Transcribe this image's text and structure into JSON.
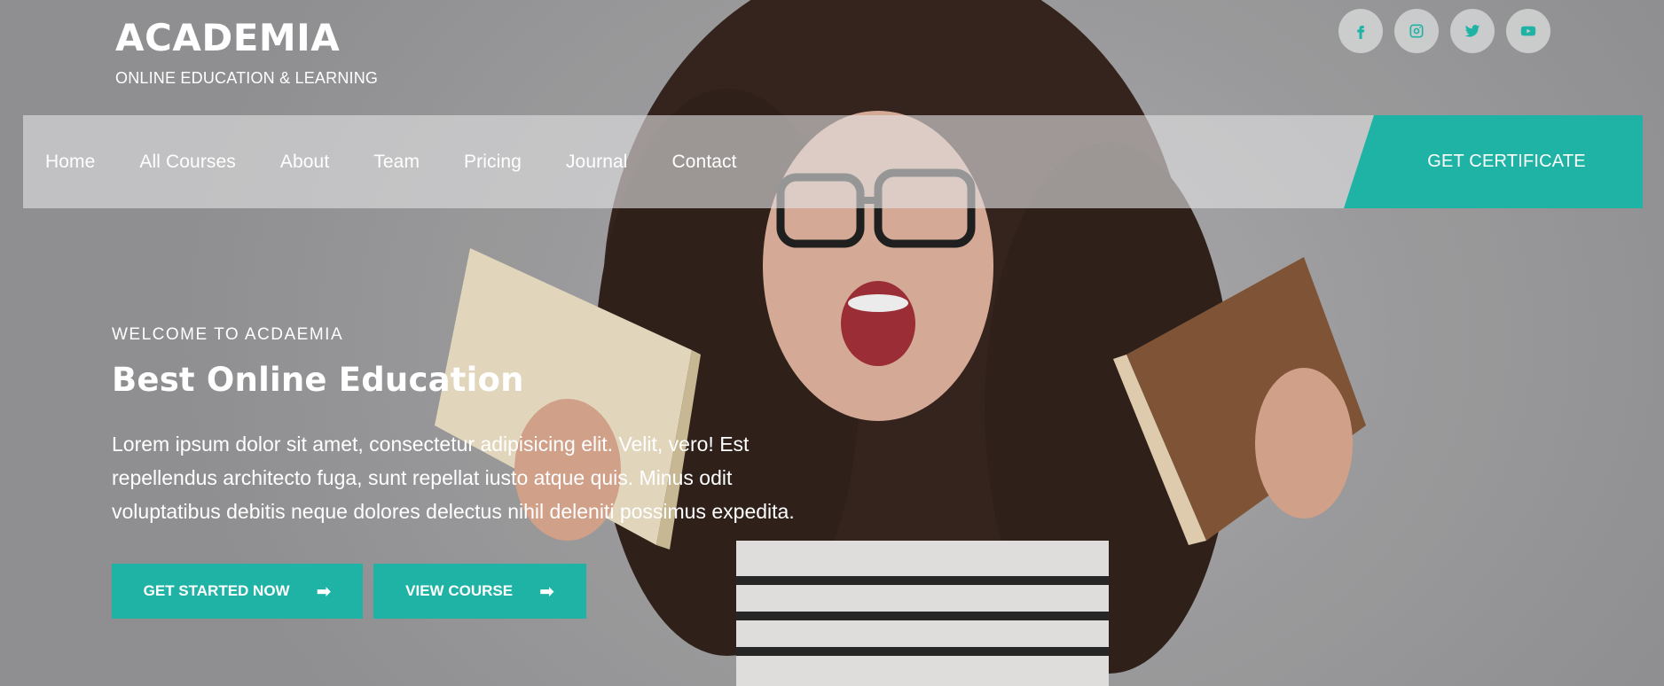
{
  "brand": {
    "title": "ACADEMIA",
    "tagline": "ONLINE EDUCATION & LEARNING"
  },
  "social": [
    {
      "icon": "facebook-icon"
    },
    {
      "icon": "instagram-icon"
    },
    {
      "icon": "twitter-icon"
    },
    {
      "icon": "youtube-icon"
    }
  ],
  "nav": {
    "items": [
      "Home",
      "All Courses",
      "About",
      "Team",
      "Pricing",
      "Journal",
      "Contact"
    ],
    "cta_label": "GET CERTIFICATE"
  },
  "hero": {
    "eyebrow": "WELCOME TO ACDAEMIA",
    "headline": "Best Online Education",
    "lead": "Lorem ipsum dolor sit amet, consectetur adipisicing elit. Velit, vero! Est repellendus architecto fuga, sunt repellat iusto atque quis. Minus odit voluptatibus debitis neque dolores delectus nihil deleniti possimus expedita.",
    "primary_cta": "GET STARTED NOW",
    "secondary_cta": "VIEW COURSE",
    "arrow_glyph": "➡"
  },
  "colors": {
    "accent": "#1fb3a6",
    "text_on_hero": "#ffffff"
  }
}
